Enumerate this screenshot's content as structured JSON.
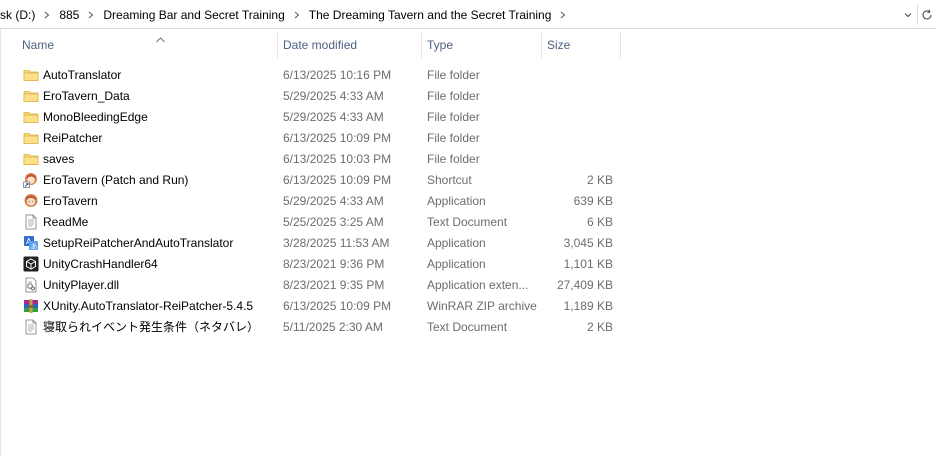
{
  "address": {
    "crumbs": [
      "sk (D:)",
      "885",
      "Dreaming Bar and Secret Training",
      "The Dreaming Tavern and the Secret Training"
    ]
  },
  "columns": {
    "name": "Name",
    "date": "Date modified",
    "type": "Type",
    "size": "Size"
  },
  "files": [
    {
      "name": "AutoTranslator",
      "date": "6/13/2025 10:16 PM",
      "type": "File folder",
      "size": "",
      "icon": "folder-icon"
    },
    {
      "name": "EroTavern_Data",
      "date": "5/29/2025 4:33 AM",
      "type": "File folder",
      "size": "",
      "icon": "folder-icon"
    },
    {
      "name": "MonoBleedingEdge",
      "date": "5/29/2025 4:33 AM",
      "type": "File folder",
      "size": "",
      "icon": "folder-icon"
    },
    {
      "name": "ReiPatcher",
      "date": "6/13/2025 10:09 PM",
      "type": "File folder",
      "size": "",
      "icon": "folder-icon"
    },
    {
      "name": "saves",
      "date": "6/13/2025 10:03 PM",
      "type": "File folder",
      "size": "",
      "icon": "folder-icon"
    },
    {
      "name": "EroTavern (Patch and Run)",
      "date": "6/13/2025 10:09 PM",
      "type": "Shortcut",
      "size": "2 KB",
      "icon": "anime-shortcut-icon"
    },
    {
      "name": "EroTavern",
      "date": "5/29/2025 4:33 AM",
      "type": "Application",
      "size": "639 KB",
      "icon": "anime-app-icon"
    },
    {
      "name": "ReadMe",
      "date": "5/25/2025 3:25 AM",
      "type": "Text Document",
      "size": "6 KB",
      "icon": "text-document-icon"
    },
    {
      "name": "SetupReiPatcherAndAutoTranslator",
      "date": "3/28/2025 11:53 AM",
      "type": "Application",
      "size": "3,045 KB",
      "icon": "translator-app-icon"
    },
    {
      "name": "UnityCrashHandler64",
      "date": "8/23/2021 9:36 PM",
      "type": "Application",
      "size": "1,101 KB",
      "icon": "unity-icon"
    },
    {
      "name": "UnityPlayer.dll",
      "date": "8/23/2021 9:35 PM",
      "type": "Application exten...",
      "size": "27,409 KB",
      "icon": "dll-icon"
    },
    {
      "name": "XUnity.AutoTranslator-ReiPatcher-5.4.5",
      "date": "6/13/2025 10:09 PM",
      "type": "WinRAR ZIP archive",
      "size": "1,189 KB",
      "icon": "winrar-icon"
    },
    {
      "name": "寝取られイベント発生条件（ネタバレ）",
      "date": "5/11/2025 2:30 AM",
      "type": "Text Document",
      "size": "2 KB",
      "icon": "text-document-icon"
    }
  ]
}
